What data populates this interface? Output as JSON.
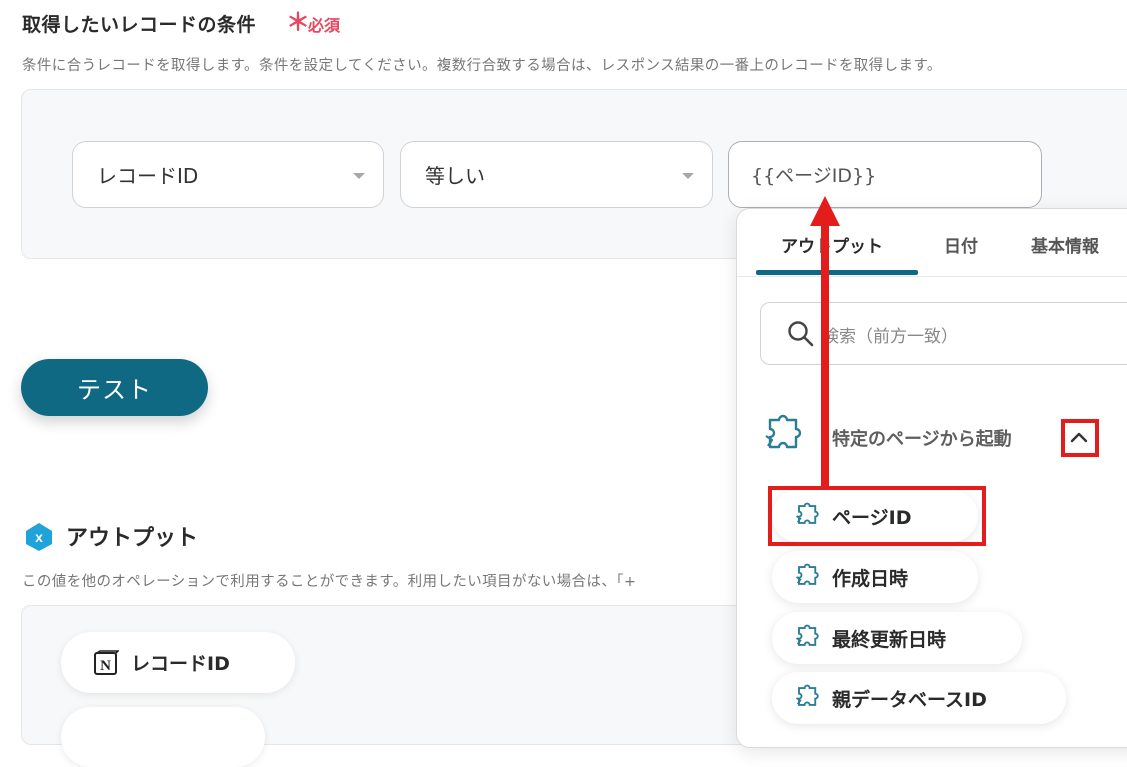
{
  "condition": {
    "title": "取得したいレコードの条件",
    "required_mark": "＊",
    "required_label": "必須",
    "description": "条件に合うレコードを取得します。条件を設定してください。複数行合致する場合は、レスポンス結果の一番上のレコードを取得します。",
    "field_select": "レコードID",
    "operator_select": "等しい",
    "value_input": "{{ページID}}"
  },
  "test_button": "テスト",
  "output": {
    "title": "アウトプット",
    "description": "この値を他のオペレーションで利用することができます。利用したい項目がない場合は、「+",
    "items": [
      "レコードID"
    ]
  },
  "dropdown": {
    "tabs": [
      "アウトプット",
      "日付",
      "基本情報"
    ],
    "active_tab": "アウトプット",
    "search_placeholder": "検索（前方一致）",
    "group_title": "特定のページから起動",
    "items": [
      "ページID",
      "作成日時",
      "最終更新日時",
      "親データベースID"
    ],
    "highlighted_item": "ページID"
  },
  "colors": {
    "accent": "#0f6982",
    "required": "#e8475f",
    "annotation": "#e31c1c"
  },
  "icons": [
    "caret-down-icon",
    "output-badge-icon",
    "notion-icon",
    "search-icon",
    "puzzle-icon",
    "chevron-up-icon"
  ]
}
